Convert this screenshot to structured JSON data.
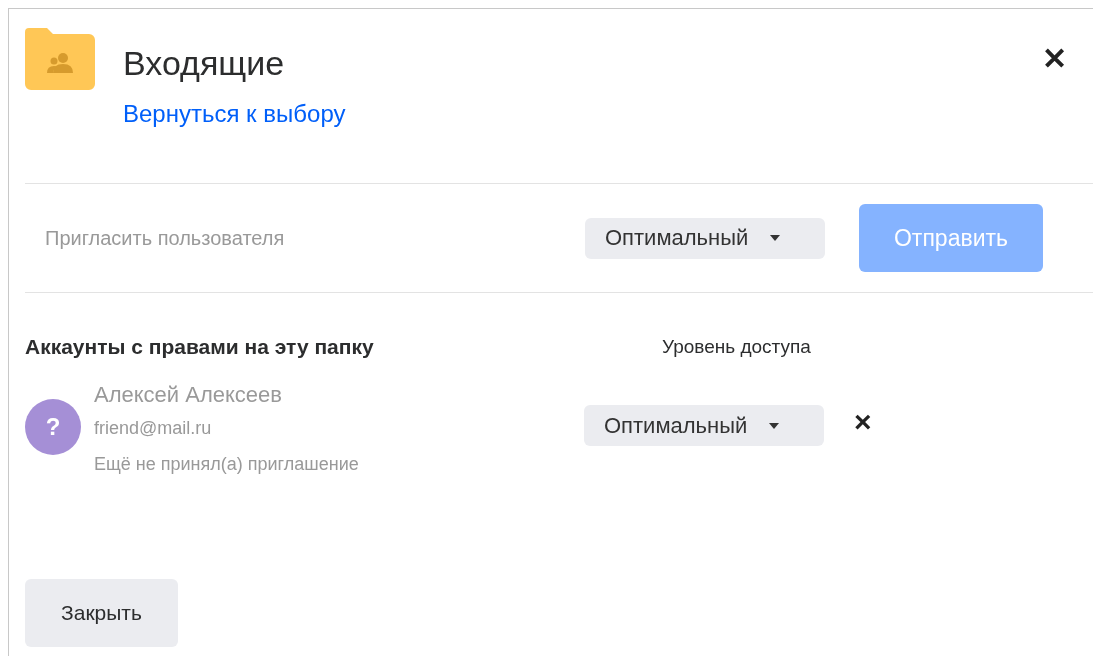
{
  "dialog": {
    "title": "Входящие",
    "back_link": "Вернуться к выбору",
    "close_icon": "✕"
  },
  "invite": {
    "placeholder": "Пригласить пользователя",
    "access": "Оптимальный",
    "send_button": {
      "label": "Отправить",
      "disabled": true
    }
  },
  "accounts": {
    "heading": "Аккаунты с правами на эту папку",
    "column_label": "Уровень доступа",
    "members": [
      {
        "avatar": "?",
        "color": "#a58fd6",
        "name": "Алексей Алексеев",
        "email": "friend@mail.ru",
        "status": "Ещё не принял(а) приглашение",
        "access": "Оптимальный",
        "remove": "×"
      }
    ]
  },
  "footer": {
    "close_button": "Закрыть"
  }
}
